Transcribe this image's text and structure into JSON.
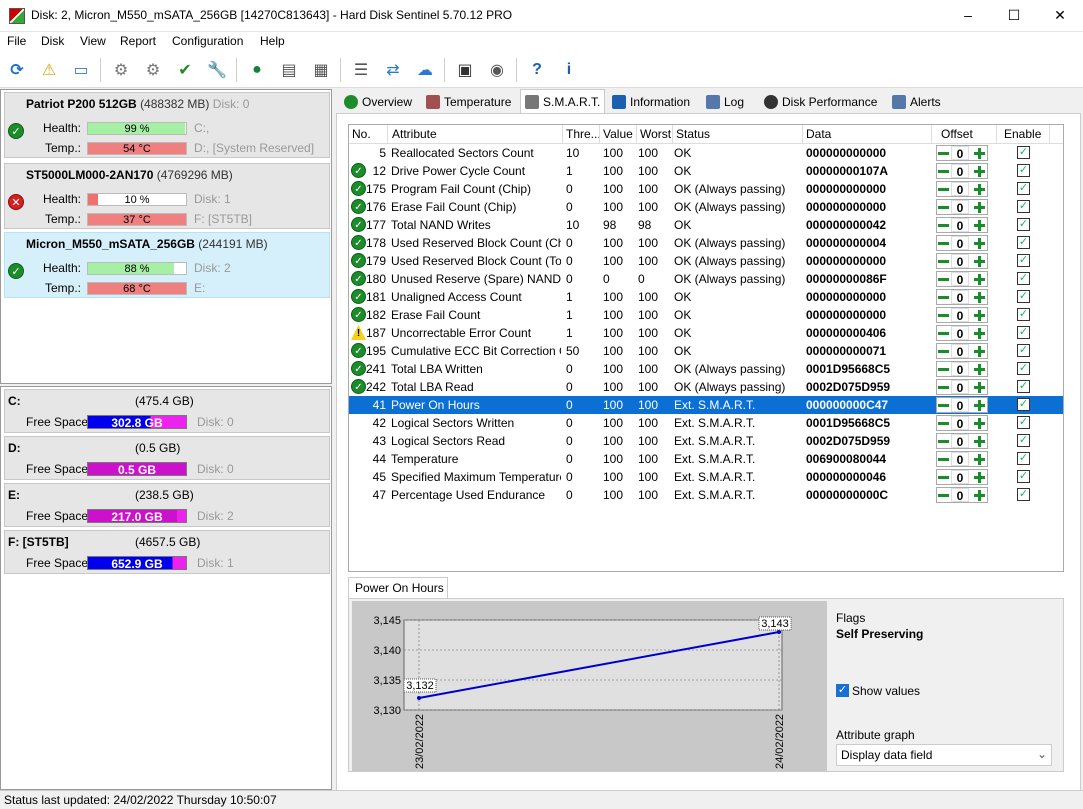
{
  "window": {
    "title": "Disk: 2, Micron_M550_mSATA_256GB [14270C813643]  -  Hard Disk Sentinel 5.70.12 PRO",
    "minimize": "–",
    "maximize": "☐",
    "close": "✕"
  },
  "menu": [
    "File",
    "Disk",
    "View",
    "Report",
    "Configuration",
    "Help"
  ],
  "toolbar_icons": [
    "refresh-icon",
    "warning-icon",
    "disk-info-icon",
    "disk-test-icon",
    "disk-test2-icon",
    "disk-check-icon",
    "disk-tools-icon",
    "network-globe-icon",
    "drives-icon",
    "printer-icon",
    "report-icon",
    "update-icon",
    "cloud-icon",
    "tasks-icon",
    "speaker-icon",
    "help-icon",
    "info-icon"
  ],
  "disks": [
    {
      "name": "Patriot P200 512GB",
      "size": "(488382 MB)",
      "disk": "Disk: 0",
      "health_label": "Health:",
      "health": "99 %",
      "health_pct": 99,
      "temp_label": "Temp.:",
      "temp": "54 °C",
      "drive1": "C:,",
      "drive2": "D:,  [System Reserved]",
      "status": "ok",
      "selected": false
    },
    {
      "name": "ST5000LM000-2AN170",
      "size": "(4769296 MB)",
      "disk": "Disk: 1",
      "health_label": "Health:",
      "health": "10 %",
      "health_pct": 10,
      "temp_label": "Temp.:",
      "temp": "37 °C",
      "drive1": "",
      "drive2": "F: [ST5TB]",
      "status": "error",
      "selected": false
    },
    {
      "name": "Micron_M550_mSATA_256GB",
      "size": "(244191 MB)",
      "disk": "Disk: 2",
      "health_label": "Health:",
      "health": "88 %",
      "health_pct": 88,
      "temp_label": "Temp.:",
      "temp": "68 °C",
      "drive1": "",
      "drive2": "E:",
      "status": "ok",
      "selected": true
    }
  ],
  "volumes": [
    {
      "letter": "C:",
      "size": "(475.4 GB)",
      "free_label": "Free Space",
      "free": "302.8 GB",
      "free_pct": 64,
      "disk": "Disk: 0",
      "color": "#0000ee"
    },
    {
      "letter": "D:",
      "size": "(0.5 GB)",
      "free_label": "Free Space",
      "free": "0.5 GB",
      "free_pct": 100,
      "disk": "Disk: 0",
      "color": "#cc11cc"
    },
    {
      "letter": "E:",
      "size": "(238.5 GB)",
      "free_label": "Free Space",
      "free": "217.0 GB",
      "free_pct": 91,
      "disk": "Disk: 2",
      "color": "#cc11cc"
    },
    {
      "letter": "F: [ST5TB]",
      "size": "(4657.5 GB)",
      "free_label": "Free Space",
      "free": "652.9 GB",
      "free_pct": 86,
      "disk": "Disk: 1",
      "color": "#0000ee"
    }
  ],
  "tabs": [
    {
      "label": "Overview",
      "icon": "check-icon"
    },
    {
      "label": "Temperature",
      "icon": "thermometer-icon"
    },
    {
      "label": "S.M.A.R.T.",
      "icon": "disk-icon",
      "active": true
    },
    {
      "label": "Information",
      "icon": "info-icon"
    },
    {
      "label": "Log",
      "icon": "log-icon"
    },
    {
      "label": "Disk Performance",
      "icon": "gauge-icon"
    },
    {
      "label": "Alerts",
      "icon": "alert-icon"
    }
  ],
  "smart": {
    "headers": [
      "No.",
      "Attribute",
      "Thre...",
      "Value",
      "Worst",
      "Status",
      "Data",
      "Offset",
      "Enable"
    ],
    "rows": [
      {
        "icon": "none",
        "no": "5",
        "attr": "Reallocated Sectors Count",
        "thr": "10",
        "val": "100",
        "worst": "100",
        "status": "OK",
        "data": "000000000000",
        "offset": "0"
      },
      {
        "icon": "ok",
        "no": "12",
        "attr": "Drive Power Cycle Count",
        "thr": "1",
        "val": "100",
        "worst": "100",
        "status": "OK",
        "data": "00000000107A",
        "offset": "0"
      },
      {
        "icon": "ok",
        "no": "175",
        "attr": "Program Fail Count (Chip)",
        "thr": "0",
        "val": "100",
        "worst": "100",
        "status": "OK (Always passing)",
        "data": "000000000000",
        "offset": "0"
      },
      {
        "icon": "ok",
        "no": "176",
        "attr": "Erase Fail Count (Chip)",
        "thr": "0",
        "val": "100",
        "worst": "100",
        "status": "OK (Always passing)",
        "data": "000000000000",
        "offset": "0"
      },
      {
        "icon": "ok",
        "no": "177",
        "attr": "Total NAND Writes",
        "thr": "10",
        "val": "98",
        "worst": "98",
        "status": "OK",
        "data": "000000000042",
        "offset": "0"
      },
      {
        "icon": "ok",
        "no": "178",
        "attr": "Used Reserved Block Count (Chip)",
        "thr": "0",
        "val": "100",
        "worst": "100",
        "status": "OK (Always passing)",
        "data": "000000000004",
        "offset": "0"
      },
      {
        "icon": "ok",
        "no": "179",
        "attr": "Used Reserved Block Count (Total)",
        "thr": "0",
        "val": "100",
        "worst": "100",
        "status": "OK (Always passing)",
        "data": "000000000000",
        "offset": "0"
      },
      {
        "icon": "ok",
        "no": "180",
        "attr": "Unused Reserve (Spare) NAND Bl...",
        "thr": "0",
        "val": "0",
        "worst": "0",
        "status": "OK (Always passing)",
        "data": "00000000086F",
        "offset": "0"
      },
      {
        "icon": "ok",
        "no": "181",
        "attr": "Unaligned Access Count",
        "thr": "1",
        "val": "100",
        "worst": "100",
        "status": "OK",
        "data": "000000000000",
        "offset": "0"
      },
      {
        "icon": "ok",
        "no": "182",
        "attr": "Erase Fail Count",
        "thr": "1",
        "val": "100",
        "worst": "100",
        "status": "OK",
        "data": "000000000000",
        "offset": "0"
      },
      {
        "icon": "warn",
        "no": "187",
        "attr": "Uncorrectable Error Count",
        "thr": "1",
        "val": "100",
        "worst": "100",
        "status": "OK",
        "data": "000000000406",
        "offset": "0"
      },
      {
        "icon": "ok",
        "no": "195",
        "attr": "Cumulative ECC Bit Correction C...",
        "thr": "50",
        "val": "100",
        "worst": "100",
        "status": "OK",
        "data": "000000000071",
        "offset": "0"
      },
      {
        "icon": "ok",
        "no": "241",
        "attr": "Total LBA Written",
        "thr": "0",
        "val": "100",
        "worst": "100",
        "status": "OK (Always passing)",
        "data": "0001D95668C5",
        "offset": "0"
      },
      {
        "icon": "ok",
        "no": "242",
        "attr": "Total LBA Read",
        "thr": "0",
        "val": "100",
        "worst": "100",
        "status": "OK (Always passing)",
        "data": "0002D075D959",
        "offset": "0"
      },
      {
        "icon": "none",
        "no": "41",
        "attr": "Power On Hours",
        "thr": "0",
        "val": "100",
        "worst": "100",
        "status": "Ext. S.M.A.R.T.",
        "data": "000000000C47",
        "offset": "0",
        "selected": true
      },
      {
        "icon": "none",
        "no": "42",
        "attr": "Logical Sectors Written",
        "thr": "0",
        "val": "100",
        "worst": "100",
        "status": "Ext. S.M.A.R.T.",
        "data": "0001D95668C5",
        "offset": "0"
      },
      {
        "icon": "none",
        "no": "43",
        "attr": "Logical Sectors Read",
        "thr": "0",
        "val": "100",
        "worst": "100",
        "status": "Ext. S.M.A.R.T.",
        "data": "0002D075D959",
        "offset": "0"
      },
      {
        "icon": "none",
        "no": "44",
        "attr": "Temperature",
        "thr": "0",
        "val": "100",
        "worst": "100",
        "status": "Ext. S.M.A.R.T.",
        "data": "006900080044",
        "offset": "0"
      },
      {
        "icon": "none",
        "no": "45",
        "attr": "Specified Maximum Temperature",
        "thr": "0",
        "val": "100",
        "worst": "100",
        "status": "Ext. S.M.A.R.T.",
        "data": "000000000046",
        "offset": "0"
      },
      {
        "icon": "none",
        "no": "47",
        "attr": "Percentage Used Endurance",
        "thr": "0",
        "val": "100",
        "worst": "100",
        "status": "Ext. S.M.A.R.T.",
        "data": "00000000000C",
        "offset": "0"
      }
    ]
  },
  "graph": {
    "tab": "Power On Hours",
    "flags_label": "Flags",
    "flags_value": "Self Preserving",
    "show_values": "Show values",
    "attr_graph_label": "Attribute graph",
    "attr_graph_value": "Display data field"
  },
  "chart_data": {
    "type": "line",
    "x": [
      "23/02/2022",
      "24/02/2022"
    ],
    "series": [
      {
        "values": [
          3132,
          3143
        ]
      }
    ],
    "yticks": [
      "3,145",
      "3,140",
      "3,135",
      "3,130"
    ],
    "ylim": [
      3130,
      3145
    ],
    "point_labels": [
      "3,132",
      "3,143"
    ],
    "grid": true,
    "line_color": "#0000cc"
  },
  "status": "Status last updated: 24/02/2022 Thursday 10:50:07"
}
